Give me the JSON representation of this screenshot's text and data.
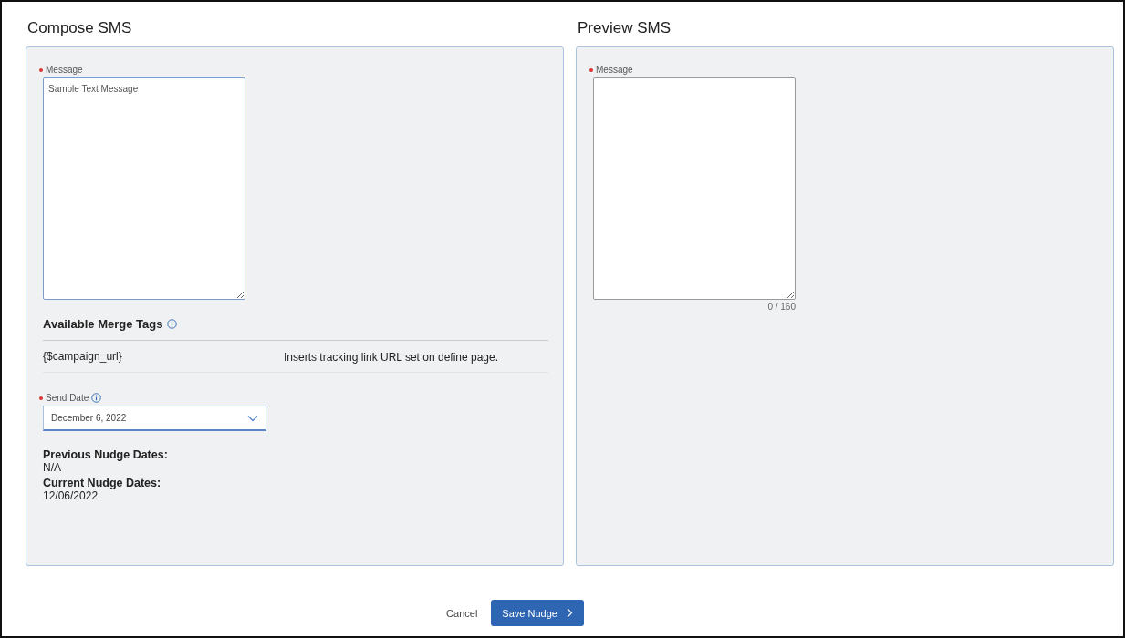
{
  "compose": {
    "title": "Compose SMS",
    "message": {
      "label": "Message",
      "required": true,
      "value": "Sample Text Message"
    },
    "merge_tags": {
      "title": "Available Merge Tags",
      "rows": [
        {
          "tag": "{$campaign_url}",
          "description": "Inserts tracking link URL set on define page."
        }
      ]
    },
    "send_date": {
      "label": "Send Date",
      "required": true,
      "value": "December 6, 2022"
    },
    "nudge_dates": [
      {
        "label": "Previous Nudge Dates:",
        "value": "N/A"
      },
      {
        "label": "Current Nudge Dates:",
        "value": "12/06/2022"
      }
    ]
  },
  "preview": {
    "title": "Preview SMS",
    "message": {
      "label": "Message",
      "required": true,
      "counter": "0 / 160"
    }
  },
  "buttons": {
    "cancel": "Cancel",
    "save": "Save Nudge"
  }
}
